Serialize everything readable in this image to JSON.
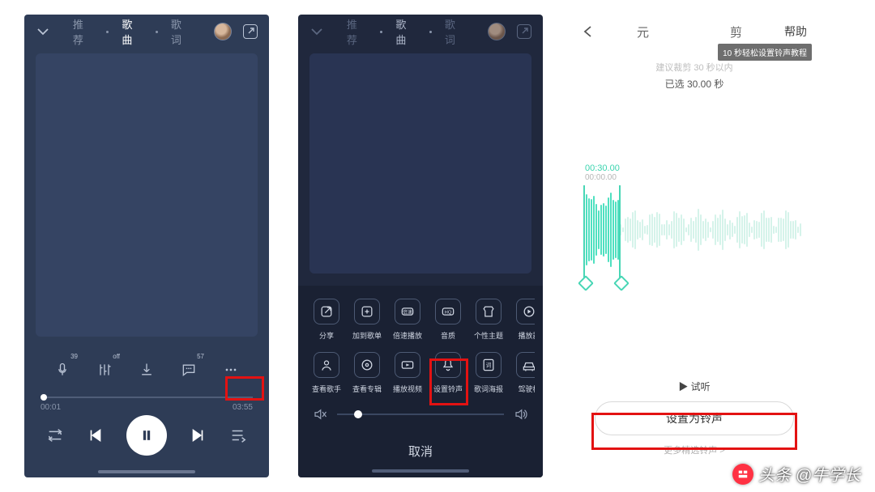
{
  "p1": {
    "tabs": [
      "推荐",
      "歌曲",
      "歌词"
    ],
    "active_tab": 1,
    "ctrl_sup": {
      "mic": "39",
      "eq": "off",
      "msg": "57"
    },
    "time_left": "00:01",
    "time_right": "03:55"
  },
  "p2": {
    "tabs": [
      "推荐",
      "歌曲",
      "歌词"
    ],
    "row1": [
      {
        "label": "分享",
        "bind": "share"
      },
      {
        "label": "加到歌单",
        "bind": "add"
      },
      {
        "label": "倍速播放",
        "bind": "speed"
      },
      {
        "label": "音质",
        "bind": "hq"
      },
      {
        "label": "个性主题",
        "bind": "theme"
      },
      {
        "label": "播放器",
        "bind": "player"
      }
    ],
    "row2": [
      {
        "label": "查看歌手",
        "bind": "artist"
      },
      {
        "label": "查看专辑",
        "bind": "album"
      },
      {
        "label": "播放视频",
        "bind": "video"
      },
      {
        "label": "设置铃声",
        "bind": "ringtone"
      },
      {
        "label": "歌词海报",
        "bind": "poster"
      },
      {
        "label": "驾驶模",
        "bind": "drive"
      }
    ],
    "cancel": "取消",
    "hq_text": "HQ",
    "speed_text": "倍速",
    "poster_text": "词"
  },
  "p3": {
    "help": "帮助",
    "center_l": "元",
    "center_r": "剪",
    "tooltip": "10 秒轻松设置铃声教程",
    "tip": "建议裁剪 30 秒以内",
    "selected": "已选 30.00 秒",
    "ts_top": "00:30.00",
    "ts_left": "00:00.00",
    "preview": "▶ 试听",
    "button": "设置为铃声",
    "more": "更多精选铃声 >"
  },
  "wm_text": "头条 @牛学长",
  "wm_logo_text": "头条"
}
